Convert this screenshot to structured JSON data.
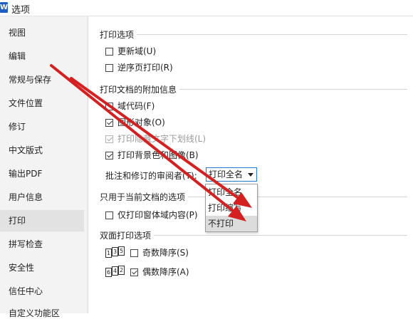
{
  "window": {
    "title": "选项",
    "logo_glyph": "W"
  },
  "sidebar": {
    "items": [
      {
        "label": "视图"
      },
      {
        "label": "编辑"
      },
      {
        "label": "常规与保存"
      },
      {
        "label": "文件位置"
      },
      {
        "label": "修订"
      },
      {
        "label": "中文版式"
      },
      {
        "label": "输出PDF"
      },
      {
        "label": "用户信息"
      },
      {
        "label": "打印",
        "selected": true
      },
      {
        "label": "拼写检查"
      },
      {
        "label": "安全性"
      },
      {
        "label": "信任中心"
      },
      {
        "label": "自定义功能区"
      }
    ]
  },
  "print_options": {
    "title": "打印选项",
    "update_fields": {
      "label": "更新域(U)",
      "checked": false
    },
    "reverse_order": {
      "label": "逆序页打印(R)",
      "checked": false
    }
  },
  "extra_info": {
    "title": "打印文档的附加信息",
    "field_codes": {
      "label": "域代码(F)",
      "checked": false
    },
    "drawing_objects": {
      "label": "图形对象(O)",
      "checked": true
    },
    "hidden_underline": {
      "label": "打印隐藏文字下划线(L)",
      "checked": true,
      "disabled": true
    },
    "background": {
      "label": "打印背景色和图像(B)",
      "checked": true
    },
    "reviewer_label": "批注和修订的审阅者(T):",
    "reviewer_value": "打印全名",
    "reviewer_options": [
      "打印全名",
      "打印缩写",
      "不打印"
    ],
    "highlighted_option_index": 2
  },
  "current_doc": {
    "title": "只用于当前文档的选项",
    "form_only": {
      "label": "仅打印窗体域内容(P)",
      "checked": false
    }
  },
  "duplex": {
    "title": "双面打印选项",
    "odd": {
      "label": "奇数降序(S)",
      "checked": false,
      "icon_pages": [
        "1",
        "3",
        "5"
      ]
    },
    "even": {
      "label": "偶数降序(A)",
      "checked": true,
      "icon_pages": [
        "6",
        "4",
        "2"
      ]
    }
  },
  "colors": {
    "accent": "#1e7ad6",
    "annotation_arrow": "#d42020",
    "selected_nav": "#e2e2e2"
  }
}
